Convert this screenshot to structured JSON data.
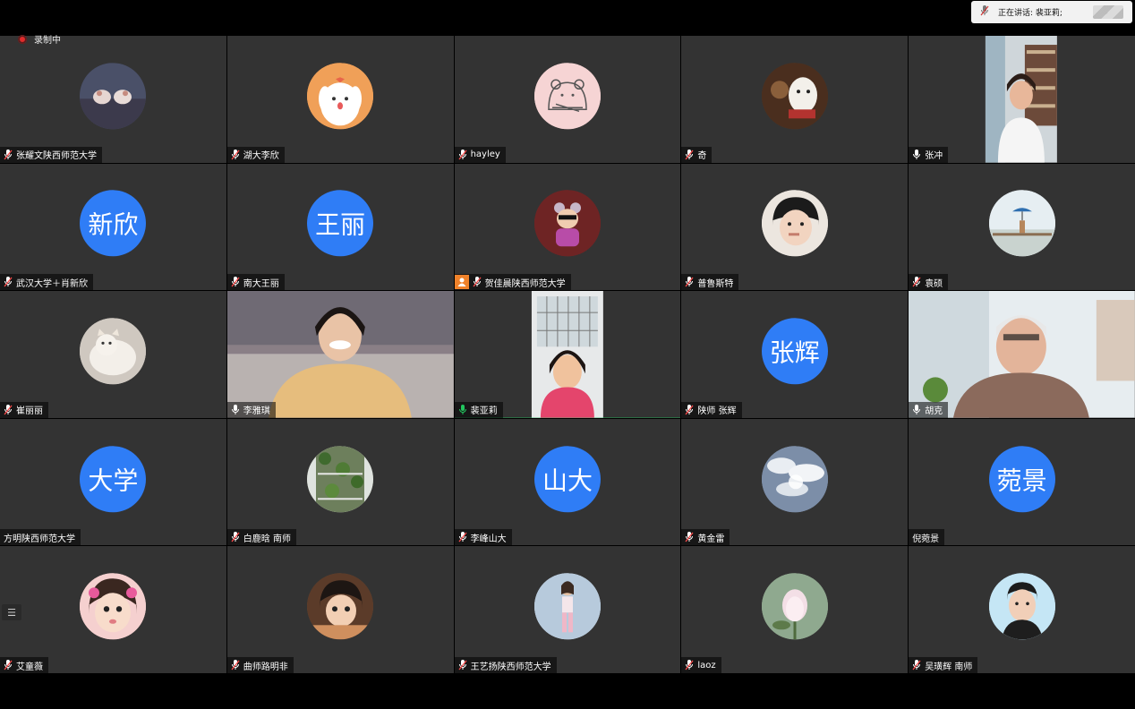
{
  "recording": {
    "label": "录制中"
  },
  "speaking": {
    "text": "正在讲话: 裴亚莉;"
  },
  "participants": [
    {
      "name": "张耀文陕西师范大学",
      "avatar_type": "photo"
    },
    {
      "name": "湖大李欣",
      "avatar_type": "photo"
    },
    {
      "name": "hayley",
      "avatar_type": "photo"
    },
    {
      "name": "奇",
      "avatar_type": "photo"
    },
    {
      "name": "张冲",
      "avatar_type": "video"
    },
    {
      "name": "武汉大学＋肖新欣",
      "avatar_type": "text",
      "avatar_text": "新欣"
    },
    {
      "name": "南大王丽",
      "avatar_type": "text",
      "avatar_text": "王丽"
    },
    {
      "name": "贺佳晨陕西师范大学",
      "avatar_type": "photo"
    },
    {
      "name": "普鲁斯特",
      "avatar_type": "photo"
    },
    {
      "name": "袁硕",
      "avatar_type": "photo"
    },
    {
      "name": "崔丽丽",
      "avatar_type": "photo"
    },
    {
      "name": "李雅琪",
      "avatar_type": "video"
    },
    {
      "name": "裴亚莉",
      "avatar_type": "video"
    },
    {
      "name": "陕师 张辉",
      "avatar_type": "text",
      "avatar_text": "张辉"
    },
    {
      "name": "胡克",
      "avatar_type": "video"
    },
    {
      "name": "方明陕西师范大学",
      "avatar_type": "text",
      "avatar_text": "大学"
    },
    {
      "name": "白鹿晗 南师",
      "avatar_type": "photo"
    },
    {
      "name": "李峰山大",
      "avatar_type": "text",
      "avatar_text": "山大"
    },
    {
      "name": "黄金雷",
      "avatar_type": "photo"
    },
    {
      "name": "倪菀景",
      "avatar_type": "text",
      "avatar_text": "菀景"
    },
    {
      "name": "艾童薇",
      "avatar_type": "photo"
    },
    {
      "name": "曲师路明非",
      "avatar_type": "photo"
    },
    {
      "name": "王艺扬陕西师范大学",
      "avatar_type": "photo"
    },
    {
      "name": "laoz",
      "avatar_type": "photo"
    },
    {
      "name": "吴璜辉 南师",
      "avatar_type": "photo"
    }
  ]
}
